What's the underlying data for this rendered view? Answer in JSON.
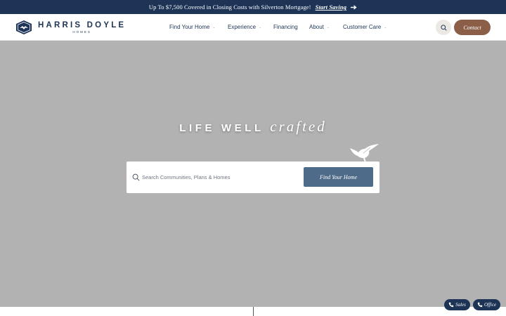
{
  "promo": {
    "text": "Up To $7,500 Covered in Closing Costs with Silverton Mortgage!",
    "link": "Start Saving",
    "icon": "arrow-right-icon"
  },
  "logo": {
    "name": "HARRIS DOYLE",
    "sub": "HOMES"
  },
  "nav": {
    "items": [
      {
        "label": "Find Your Home",
        "has_dropdown": true
      },
      {
        "label": "Experience",
        "has_dropdown": true
      },
      {
        "label": "Financing",
        "has_dropdown": false
      },
      {
        "label": "About",
        "has_dropdown": true
      },
      {
        "label": "Customer Care",
        "has_dropdown": true
      }
    ],
    "chevron": "⌄"
  },
  "header": {
    "search_icon": "search-icon",
    "contact": "Contact"
  },
  "hero": {
    "tagline_main": "LIFE WELL",
    "tagline_script": "crafted",
    "search_placeholder": "Search Communities, Plans & Homes",
    "search_button": "Find Your Home"
  },
  "floating": {
    "sales": "Sales",
    "office": "Office"
  },
  "colors": {
    "navy": "#1d3457",
    "brown": "#8b5e48",
    "slate_blue": "#4e6c8a",
    "hero_gray": "#b2b2b2"
  }
}
